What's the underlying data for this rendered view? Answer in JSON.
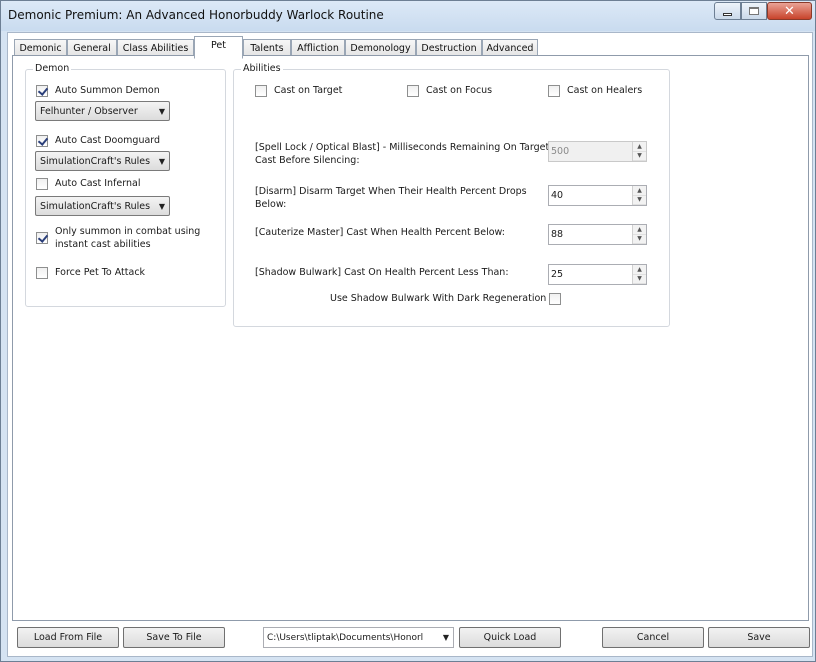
{
  "window": {
    "title": "Demonic Premium: An Advanced Honorbuddy Warlock Routine",
    "min_icon": "minimize-icon",
    "max_icon": "maximize-icon",
    "close_icon": "close-icon",
    "close_glyph": "✕"
  },
  "tabs": [
    "Demonic",
    "General",
    "Class Abilities",
    "Pet",
    "Talents",
    "Affliction",
    "Demonology",
    "Destruction",
    "Advanced"
  ],
  "active_tab": "Pet",
  "demon": {
    "legend": "Demon",
    "auto_summon": {
      "label": "Auto Summon Demon",
      "checked": true
    },
    "summon_select": "Felhunter / Observer",
    "doomguard": {
      "label": "Auto Cast Doomguard",
      "checked": true
    },
    "doomguard_select": "SimulationCraft's Rules",
    "infernal": {
      "label": "Auto Cast Infernal",
      "checked": false
    },
    "infernal_select": "SimulationCraft's Rules",
    "instant_only": {
      "label_line1": "Only summon in combat using",
      "label_line2": "instant cast abilities",
      "checked": true
    },
    "force_attack": {
      "label": "Force Pet To Attack",
      "checked": false
    }
  },
  "abilities": {
    "legend": "Abilities",
    "cast_target": {
      "label": "Cast on Target",
      "checked": false
    },
    "cast_focus": {
      "label": "Cast on Focus",
      "checked": false
    },
    "cast_healers": {
      "label": "Cast on Healers",
      "checked": false
    },
    "spell_lock": {
      "line1": "[Spell Lock / Optical Blast] - Milliseconds Remaining On Target",
      "line2": "Cast Before Silencing:",
      "value": "500",
      "enabled": false
    },
    "disarm": {
      "line1": "[Disarm] Disarm Target When Their Health Percent Drops",
      "line2": "Below:",
      "value": "40"
    },
    "cauterize": {
      "label": "[Cauterize Master] Cast When Health Percent Below:",
      "value": "88"
    },
    "shadow_bulwark": {
      "label": "[Shadow Bulwark] Cast On Health Percent Less Than:",
      "value": "25"
    },
    "bulwark_dark_regen": {
      "label": "Use Shadow Bulwark With Dark Regeneration",
      "checked": false
    }
  },
  "bottom": {
    "load_label": "Load From File",
    "save_file_label": "Save To File",
    "path_value": "C:\\Users\\tliptak\\Documents\\Honorl",
    "quick_load_label": "Quick Load",
    "cancel_label": "Cancel",
    "save_label": "Save"
  }
}
